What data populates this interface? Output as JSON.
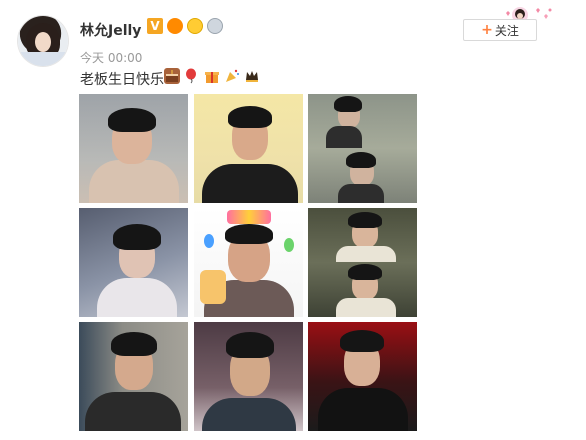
{
  "user": {
    "name": "林允Jelly",
    "verified_label": "V"
  },
  "post": {
    "time": "今天 00:00",
    "text": "老板生日快乐",
    "emoji_icons": [
      "cake-icon",
      "balloon-icon",
      "gift-icon",
      "party-popper-icon",
      "crown-icon"
    ]
  },
  "follow_button": {
    "label": "关注",
    "plus": "+"
  },
  "colors": {
    "accent": "#ff8140",
    "verified": "#f5a623",
    "timestamp": "#999999"
  },
  "photos": [
    {
      "name": "photo-1"
    },
    {
      "name": "photo-2"
    },
    {
      "name": "photo-3"
    },
    {
      "name": "photo-4"
    },
    {
      "name": "photo-5"
    },
    {
      "name": "photo-6"
    },
    {
      "name": "photo-7"
    },
    {
      "name": "photo-8"
    },
    {
      "name": "photo-9"
    }
  ]
}
